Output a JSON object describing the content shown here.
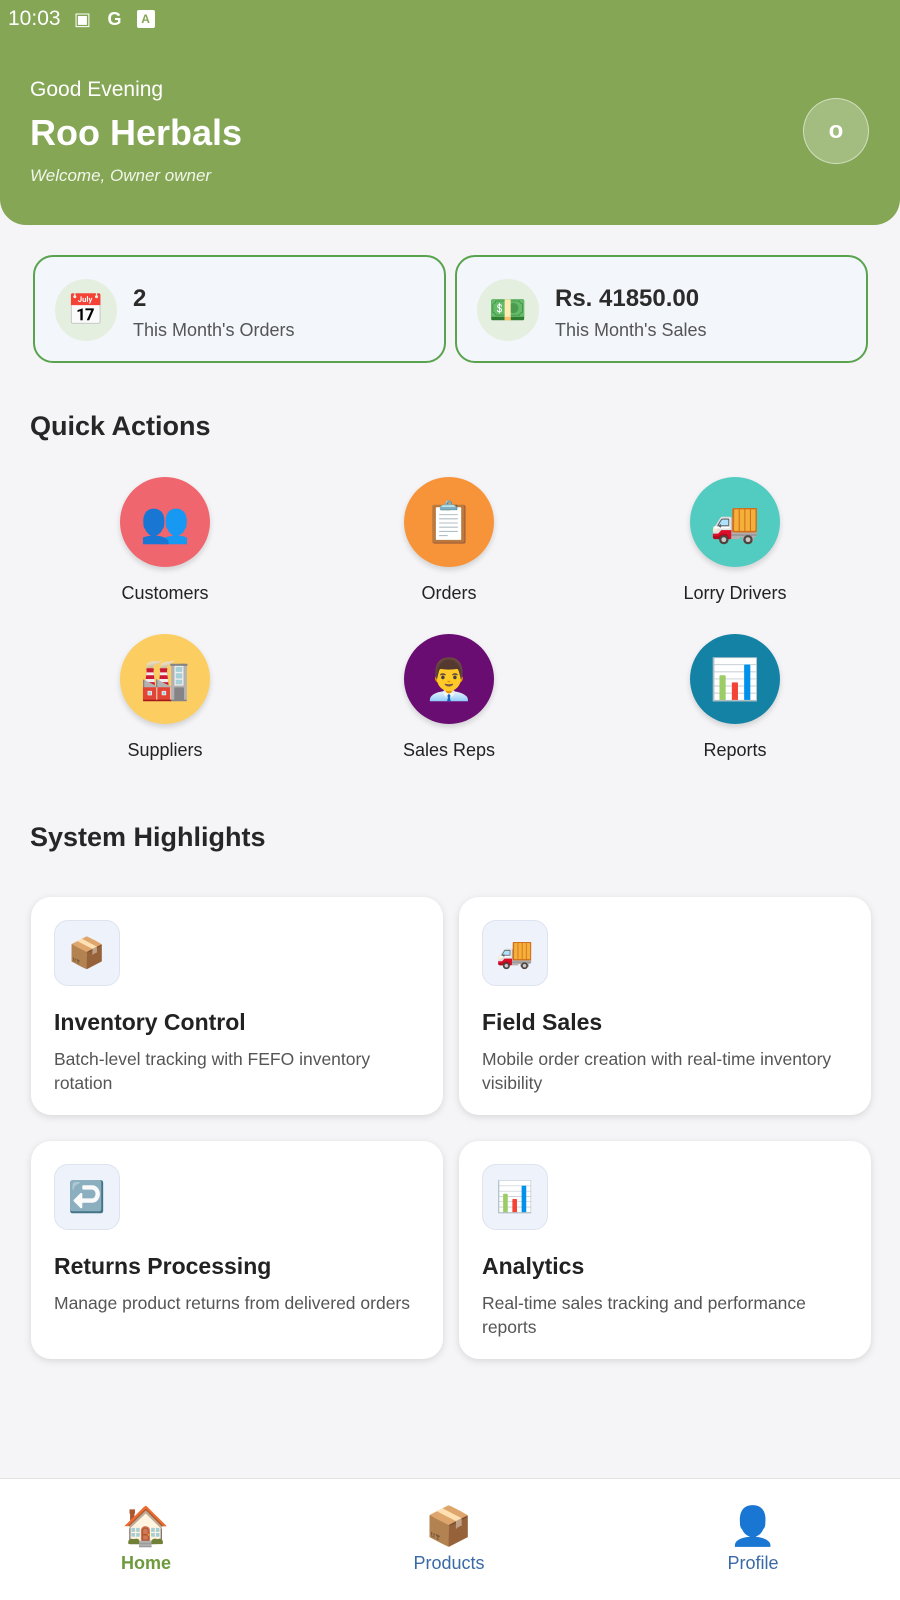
{
  "status_bar": {
    "time": "10:03",
    "icons": [
      "image-icon",
      "google-icon",
      "text-icon"
    ]
  },
  "header": {
    "greeting": "Good Evening",
    "title": "Roo Herbals",
    "welcome": "Welcome, Owner owner",
    "avatar_initial": "o",
    "color": "#84a655"
  },
  "stats": [
    {
      "icon": "calendar-icon",
      "glyph": "📅",
      "value": "2",
      "label": "This Month's Orders"
    },
    {
      "icon": "money-icon",
      "glyph": "💵",
      "value": "Rs. 41850.00",
      "label": "This Month's Sales"
    }
  ],
  "quick_actions": {
    "title": "Quick Actions",
    "items": [
      {
        "label": "Customers",
        "icon": "people-icon",
        "glyph": "👥",
        "color": "#f0666e"
      },
      {
        "label": "Orders",
        "icon": "clipboard-icon",
        "glyph": "📋",
        "color": "#f7943a"
      },
      {
        "label": "Lorry Drivers",
        "icon": "truck-icon",
        "glyph": "🚚",
        "color": "#52cbc1"
      },
      {
        "label": "Suppliers",
        "icon": "factory-icon",
        "glyph": "🏭",
        "color": "#fcce62"
      },
      {
        "label": "Sales Reps",
        "icon": "office-worker-icon",
        "glyph": "👨‍💼",
        "color": "#6a0d73"
      },
      {
        "label": "Reports",
        "icon": "bar-chart-icon",
        "glyph": "📊",
        "color": "#1482a4"
      }
    ]
  },
  "highlights": {
    "title": "System Highlights",
    "items": [
      {
        "title": "Inventory Control",
        "desc": "Batch-level tracking with FEFO inventory rotation",
        "icon": "package-icon",
        "glyph": "📦"
      },
      {
        "title": "Field Sales",
        "desc": "Mobile order creation with real-time inventory visibility",
        "icon": "truck-icon",
        "glyph": "🚚"
      },
      {
        "title": "Returns Processing",
        "desc": "Manage product returns from delivered orders",
        "icon": "return-arrow-icon",
        "glyph": "↩️"
      },
      {
        "title": "Analytics",
        "desc": "Real-time sales tracking and performance reports",
        "icon": "bar-chart-icon",
        "glyph": "📊"
      }
    ]
  },
  "bottom_nav": [
    {
      "label": "Home",
      "icon": "home-icon",
      "glyph": "🏠",
      "active": true
    },
    {
      "label": "Products",
      "icon": "package-icon",
      "glyph": "📦",
      "active": false
    },
    {
      "label": "Profile",
      "icon": "user-icon",
      "glyph": "👤",
      "active": false
    }
  ]
}
